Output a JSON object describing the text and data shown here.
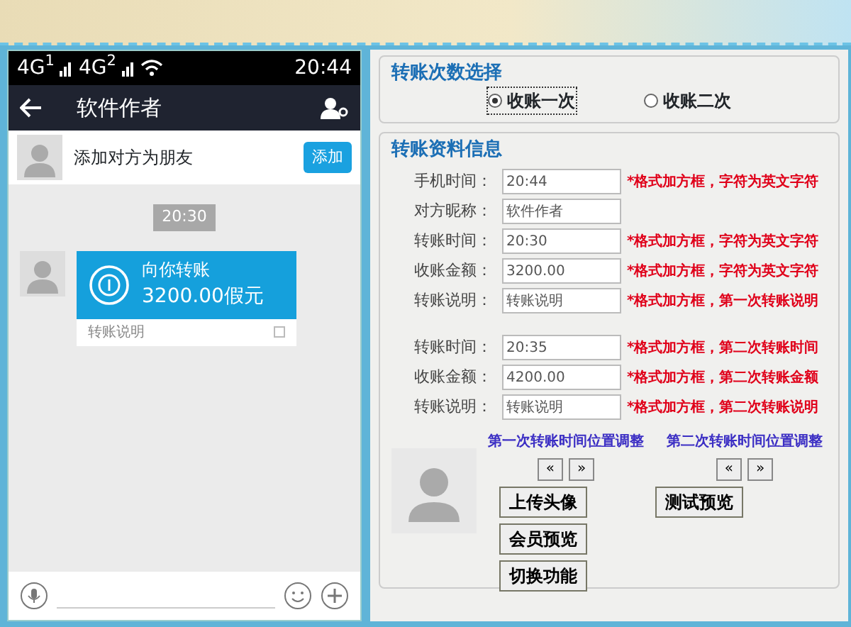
{
  "phone": {
    "status_bar": {
      "network_1": "4G$^{1}$",
      "network_2": "4G$^{2}$",
      "time": "20:44"
    },
    "title_bar": {
      "title": "软件作者"
    },
    "add_friend": {
      "text": "添加对方为朋友",
      "button": "添加"
    },
    "timestamp": "20:30",
    "transfer_message": {
      "title": "向你转账",
      "amount": "3200.00假元",
      "note": "转账说明"
    }
  },
  "count_section": {
    "legend": "转账次数选择",
    "options": [
      {
        "label": "收账一次",
        "selected": true
      },
      {
        "label": "收账二次",
        "selected": false
      }
    ]
  },
  "info_section": {
    "legend": "转账资料信息",
    "fields": [
      {
        "label": "手机时间：",
        "value": "20:44",
        "note": "*格式加方框，字符为英文字符"
      },
      {
        "label": "对方昵称：",
        "value": "软件作者"
      },
      {
        "label": "转账时间：",
        "value": "20:30",
        "note": "*格式加方框，字符为英文字符"
      },
      {
        "label": "收账金额：",
        "value": "3200.00",
        "note": "*格式加方框，字符为英文字符"
      },
      {
        "label": "转账说明：",
        "value": "转账说明",
        "note": "*格式加方框，第一次转账说明"
      },
      {
        "label": "转账时间：",
        "value": "20:35",
        "note": "*格式加方框，第二次转账时间",
        "gap": true
      },
      {
        "label": "收账金额：",
        "value": "4200.00",
        "note": "*格式加方框，第二次转账金额"
      },
      {
        "label": "转账说明：",
        "value": "转账说明",
        "note": "*格式加方框，第二次转账说明"
      }
    ],
    "adjusters": [
      {
        "title": "第一次转账时间位置调整",
        "buttons": [
          "«",
          "»"
        ]
      },
      {
        "title": "第二次转账时间位置调整",
        "buttons": [
          "«",
          "»"
        ]
      }
    ],
    "actions": [
      [
        "上传头像",
        "测试预览"
      ],
      [
        "会员预览"
      ],
      [
        "切换功能"
      ]
    ]
  }
}
